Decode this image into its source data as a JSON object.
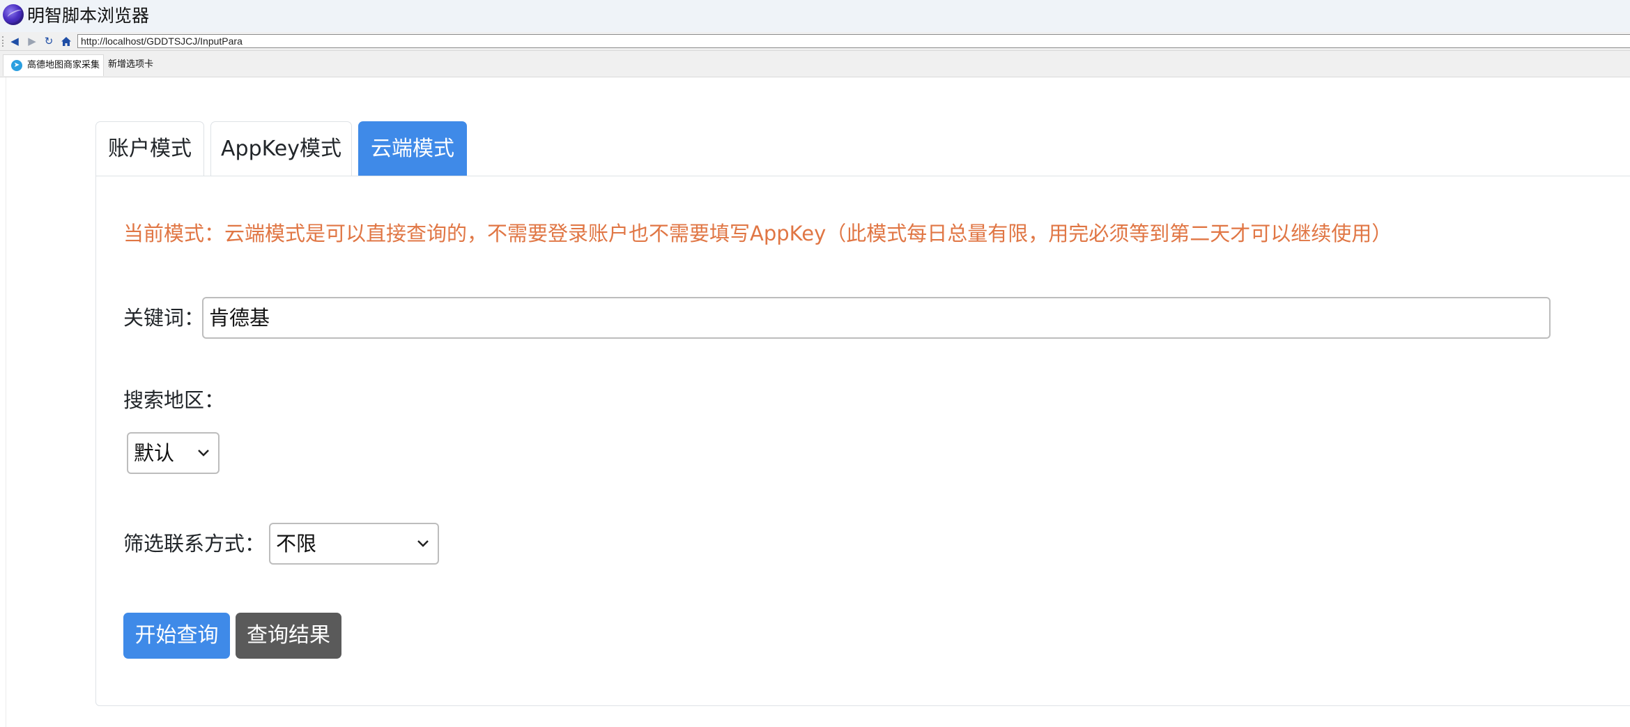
{
  "window": {
    "title": "明智脚本浏览器"
  },
  "nav": {
    "url": "http://localhost/GDDTSJCJ/InputPara",
    "back_icon": "triangle-left",
    "forward_icon": "triangle-right",
    "refresh_icon": "refresh",
    "home_icon": "home"
  },
  "browser_tabs": [
    {
      "label": "高德地图商家采集",
      "active": true,
      "icon": "telegram-plane-icon"
    },
    {
      "label": "新增选项卡",
      "active": false
    }
  ],
  "mode_tabs": [
    {
      "label": "账户模式",
      "active": false
    },
    {
      "label": "AppKey模式",
      "active": false
    },
    {
      "label": "云端模式",
      "active": true
    }
  ],
  "notice": "当前模式：云端模式是可以直接查询的，不需要登录账户也不需要填写AppKey（此模式每日总量有限，用完必须等到第二天才可以继续使用）",
  "form": {
    "keyword_label": "关键词：",
    "keyword_value": "肯德基",
    "region_label": "搜索地区：",
    "region_value": "默认",
    "contact_label": "筛选联系方式：",
    "contact_value": "不限"
  },
  "buttons": {
    "start": "开始查询",
    "results": "查询结果"
  },
  "colors": {
    "accent": "#3f8ae8",
    "notice": "#e07644",
    "secondary_button": "#5a5a5a"
  }
}
